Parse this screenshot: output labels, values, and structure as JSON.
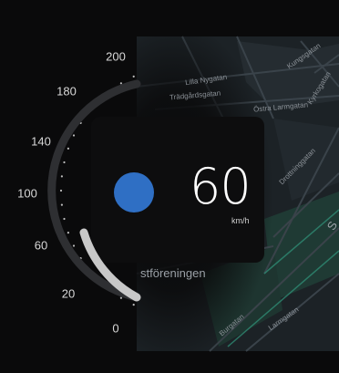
{
  "speedometer": {
    "speed": "60",
    "unit": "km/h",
    "scale_labels": [
      "0",
      "20",
      "60",
      "100",
      "140",
      "180",
      "200"
    ],
    "indicator_color": "#2f6fc4"
  },
  "map": {
    "streets": [
      {
        "name": "Lilla Nygatan"
      },
      {
        "name": "Trädgårdsgatan"
      },
      {
        "name": "Östra Larmgatan"
      },
      {
        "name": "Kyrkogatan"
      },
      {
        "name": "Drottninggatan"
      },
      {
        "name": "Kungsgatan"
      },
      {
        "name": "stföreningen"
      },
      {
        "name": "Burgatan"
      },
      {
        "name": "Larmgatan"
      },
      {
        "name": "S"
      }
    ]
  }
}
